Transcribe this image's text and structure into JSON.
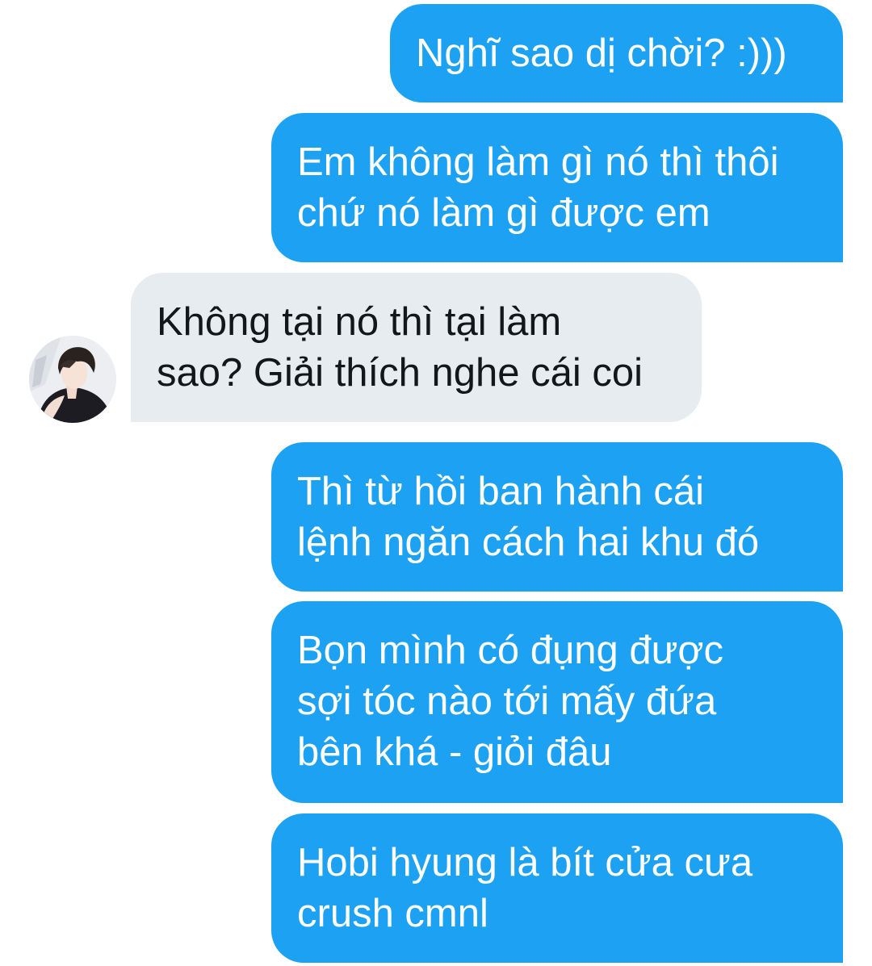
{
  "conversation": {
    "messages": [
      {
        "sender": "me",
        "text": "Nghĩ sao dị chời? :)))"
      },
      {
        "sender": "me",
        "text": "Em không làm gì nó thì thôi\nchứ nó làm gì được em"
      },
      {
        "sender": "other",
        "text": "Không tại nó thì tại làm\nsao? Giải thích nghe cái coi"
      },
      {
        "sender": "me",
        "text": "Thì từ hồi ban hành cái\nlệnh ngăn cách hai khu đó"
      },
      {
        "sender": "me",
        "text": "Bọn mình có đụng được\nsợi tóc nào tới mấy đứa\nbên khá - giỏi đâu"
      },
      {
        "sender": "me",
        "text": "Hobi hyung là bít cửa cưa\ncrush cmnl"
      }
    ]
  },
  "colors": {
    "outgoing_bubble": "#1da1f2",
    "incoming_bubble": "#e6ecf0",
    "outgoing_text": "#ffffff",
    "incoming_text": "#14171a"
  },
  "icons": {
    "avatar": "contact-avatar-photo"
  }
}
